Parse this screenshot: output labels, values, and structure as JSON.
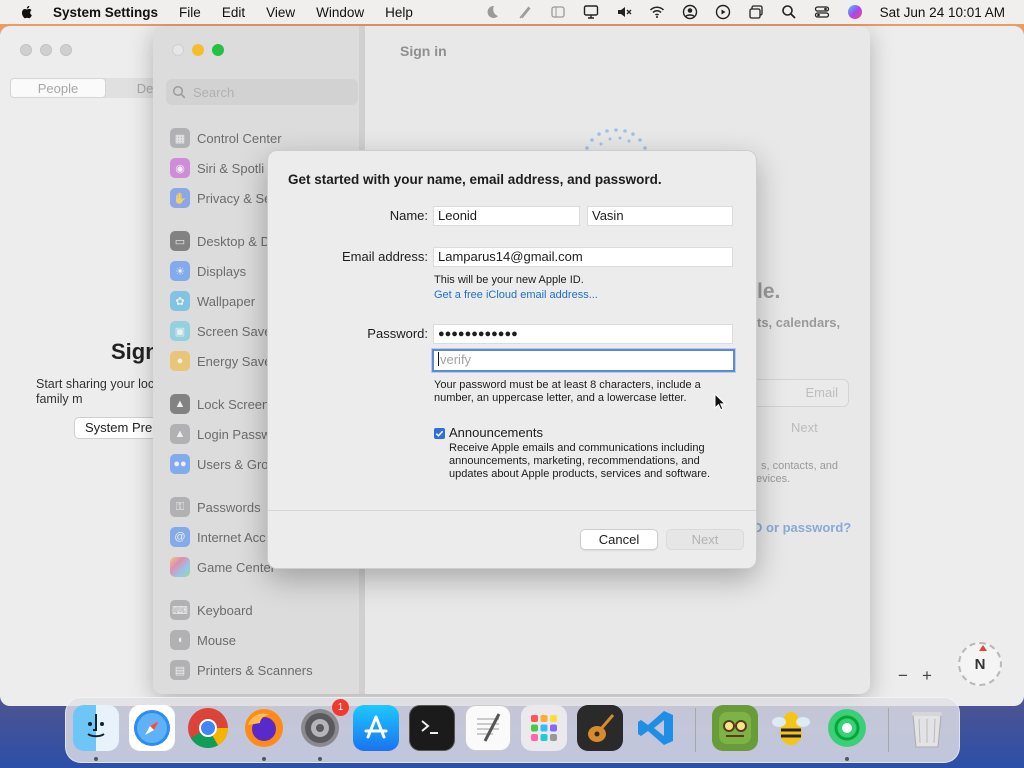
{
  "menubar": {
    "app_name": "System Settings",
    "menus": [
      "File",
      "Edit",
      "View",
      "Window",
      "Help"
    ],
    "clock": "Sat Jun 24  10:01 AM"
  },
  "background_window": {
    "tabs": [
      "People",
      "Devic"
    ],
    "sign_title": "Sign",
    "sign_text": "Start sharing your loc or family m",
    "sys_button": "System Pre",
    "zoom_minus": "−",
    "zoom_plus": "+",
    "compass": "N"
  },
  "main_window": {
    "title": "Sign in",
    "search_placeholder": "Search",
    "sidebar": [
      {
        "label": "Control Center",
        "color": "#8e8e93"
      },
      {
        "label": "Siri & Spotli",
        "color": "#c44bd8"
      },
      {
        "label": "Privacy & Se",
        "color": "#4a7cf0"
      },
      {
        "label": "Desktop & D",
        "color": "#3a3a3c"
      },
      {
        "label": "Displays",
        "color": "#3b82f6"
      },
      {
        "label": "Wallpaper",
        "color": "#38b0e8"
      },
      {
        "label": "Screen Save",
        "color": "#5ac8e0"
      },
      {
        "label": "Energy Save",
        "color": "#f2b42a"
      },
      {
        "label": "Lock Screen",
        "color": "#3a3a3c"
      },
      {
        "label": "Login Passw",
        "color": "#8e8e93"
      },
      {
        "label": "Users & Gro",
        "color": "#3b82f6"
      },
      {
        "label": "Passwords",
        "color": "#8e8e93"
      },
      {
        "label": "Internet Acc",
        "color": "#3b82f6"
      },
      {
        "label": "Game Center",
        "color": "#e54d8a"
      },
      {
        "label": "Keyboard",
        "color": "#8e8e93"
      },
      {
        "label": "Mouse",
        "color": "#8e8e93"
      },
      {
        "label": "Printers & Scanners",
        "color": "#8e8e93"
      }
    ],
    "pane_text_1": "le.",
    "pane_text_2": "ts, calendars,",
    "email_placeholder": "Email",
    "next_faded": "Next",
    "pane_text_3": "s, contacts, and",
    "pane_text_4": "evices.",
    "forgot_link": "D or password?"
  },
  "dialog": {
    "heading": "Get started with your name, email address, and password.",
    "name_label": "Name:",
    "first_name": "Leonid",
    "last_name": "Vasin",
    "email_label": "Email address:",
    "email_value": "Lamparus14@gmail.com",
    "apple_id_note": "This will be your new Apple ID.",
    "icloud_link": "Get a free iCloud email address...",
    "password_label": "Password:",
    "password_value": "●●●●●●●●●●●●",
    "verify_placeholder": "verify",
    "password_rules_1": "Your password must be at least 8 characters, include a",
    "password_rules_2": "number, an uppercase letter, and a lowercase letter.",
    "announcements_label": "Announcements",
    "announcements_checked": true,
    "announcements_desc_1": "Receive Apple emails and communications including",
    "announcements_desc_2": "announcements, marketing, recommendations, and",
    "announcements_desc_3": "updates about Apple products, services and software.",
    "cancel_label": "Cancel",
    "next_label": "Next"
  },
  "dock": {
    "apps": [
      "finder",
      "safari",
      "chrome",
      "firefox",
      "system-settings",
      "app-store",
      "terminal",
      "textedit",
      "launchpad",
      "garageband",
      "vscode",
      "game",
      "bee-app",
      "android-app",
      "trash"
    ],
    "system_settings_badge": "1"
  },
  "colors": {
    "accent": "#2f6fd6",
    "link": "#1f6fce",
    "focus_ring": "#5d8ad4"
  }
}
